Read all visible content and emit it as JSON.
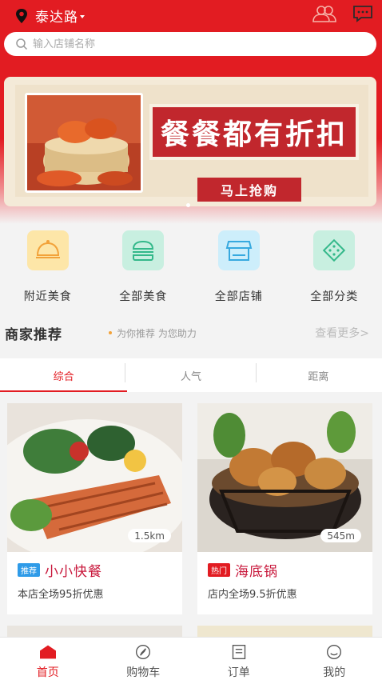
{
  "location": {
    "city": "泰达路",
    "icon": "location-pin-icon"
  },
  "header_icons": [
    "users-icon",
    "message-icon"
  ],
  "search": {
    "placeholder": "输入店铺名称",
    "icon": "search-icon"
  },
  "banner": {
    "slogan": "餐餐都有折扣",
    "button": "马上抢购",
    "dots": 1
  },
  "categories": [
    {
      "label": "附近美食",
      "icon": "cloche-icon",
      "color": "#fde6a8"
    },
    {
      "label": "全部美食",
      "icon": "burger-icon",
      "color": "#c8efe0"
    },
    {
      "label": "全部店铺",
      "icon": "store-icon",
      "color": "#cdeefb"
    },
    {
      "label": "全部分类",
      "icon": "grid-icon",
      "color": "#c8efe0"
    }
  ],
  "recommend": {
    "title": "商家推荐",
    "subtitle": "为你推荐 为您助力",
    "more": "查看更多>"
  },
  "tabs": [
    {
      "label": "综合",
      "active": true
    },
    {
      "label": "人气"
    },
    {
      "label": "距离"
    }
  ],
  "shops": [
    {
      "name": "小小快餐",
      "badge": "推荐",
      "badge_color": "#2f9be8",
      "distance": "1.5km",
      "promo": "本店全场95折优惠",
      "image": "grilled-salmon-photo"
    },
    {
      "name": "海底锅",
      "badge": "热门",
      "badge_color": "#e21c22",
      "distance": "545m",
      "promo": "店内全场9.5折优惠",
      "image": "fried-chicken-photo"
    }
  ],
  "tabbar": [
    {
      "label": "首页",
      "icon": "home-icon",
      "active": true
    },
    {
      "label": "购物车",
      "icon": "compass-icon"
    },
    {
      "label": "订单",
      "icon": "order-icon"
    },
    {
      "label": "我的",
      "icon": "profile-icon"
    }
  ],
  "colors": {
    "primary": "#e21c22",
    "shop_name": "#c8173b"
  }
}
